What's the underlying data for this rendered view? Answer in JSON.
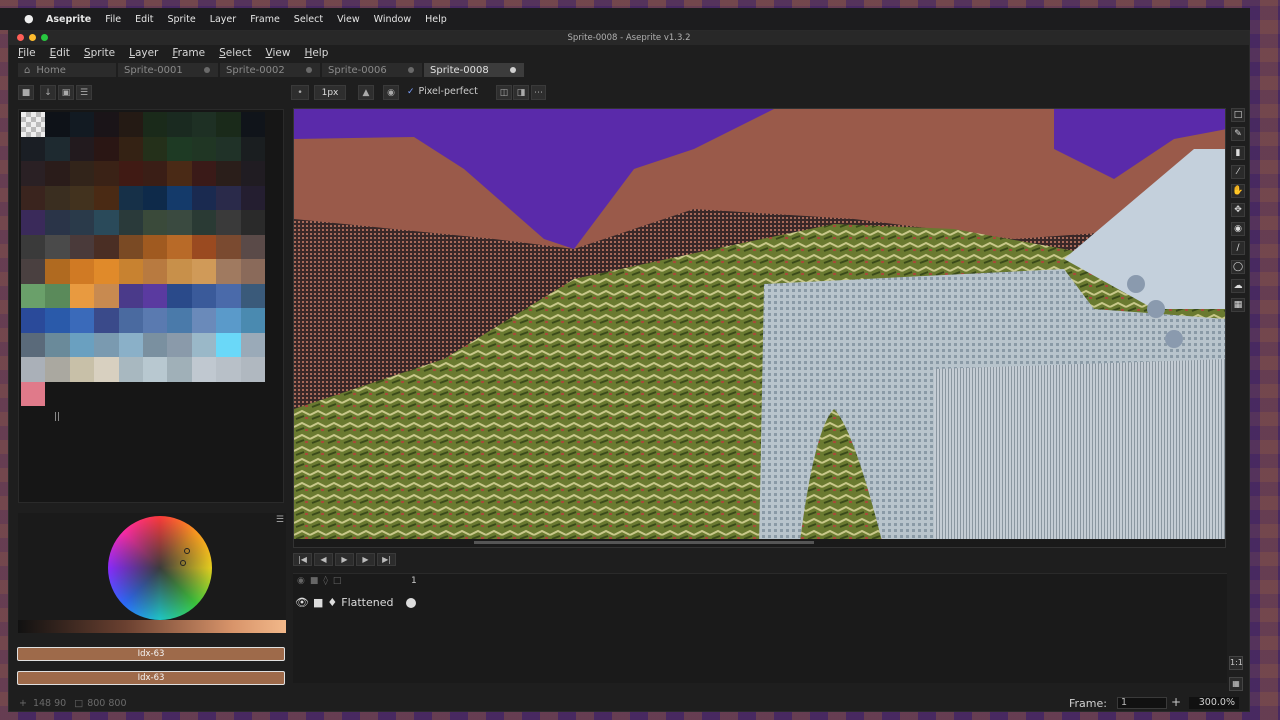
{
  "mac_menubar": {
    "items": [
      "Aseprite",
      "File",
      "Edit",
      "Sprite",
      "Layer",
      "Frame",
      "Select",
      "View",
      "Window",
      "Help"
    ]
  },
  "window": {
    "title": "Sprite-0008 - Aseprite v1.3.2"
  },
  "app_menu": {
    "items": [
      "File",
      "Edit",
      "Sprite",
      "Layer",
      "Frame",
      "Select",
      "View",
      "Help"
    ]
  },
  "tabs": [
    {
      "label": "Home",
      "active": false
    },
    {
      "label": "Sprite-0001",
      "active": false
    },
    {
      "label": "Sprite-0002",
      "active": false
    },
    {
      "label": "Sprite-0006",
      "active": false
    },
    {
      "label": "Sprite-0008",
      "active": true
    }
  ],
  "toolbar": {
    "brush_size": "1px",
    "pixel_perfect_label": "Pixel-perfect"
  },
  "palette": {
    "colors": [
      "#ffffff",
      "#0e1218",
      "#121a22",
      "#1a1418",
      "#241a14",
      "#1a2a1a",
      "#1a2a20",
      "#1e3024",
      "#1a2a1a",
      "#10141a",
      "#1a1e24",
      "#1e2a30",
      "#221a1e",
      "#2a1614",
      "#342214",
      "#24301a",
      "#1e3a24",
      "#203624",
      "#203228",
      "#1a1e20",
      "#2a2024",
      "#2a1c1a",
      "#32241a",
      "#3a2216",
      "#401a14",
      "#3a1e16",
      "#4a2a16",
      "#3a1a18",
      "#2a1e1a",
      "#201c22",
      "#3a241e",
      "#3a2e20",
      "#42321e",
      "#4a2a14",
      "#163048",
      "#0e2a4a",
      "#143a6a",
      "#1a2a50",
      "#2a2a4a",
      "#241e30",
      "#3a2a5a",
      "#2a3448",
      "#2a3a4a",
      "#2a4a5a",
      "#2a3a3a",
      "#3a4a3a",
      "#3a4a40",
      "#2a3a34",
      "#3a3a3a",
      "#2a2a2a",
      "#3a3a3a",
      "#4a4a4a",
      "#4a3a3a",
      "#4a2e24",
      "#7a4a24",
      "#a05a20",
      "#b86a28",
      "#9a4a20",
      "#7a4a30",
      "#5a4a48",
      "#4a4040",
      "#b06a20",
      "#d07a24",
      "#e08a2a",
      "#c88230",
      "#b87a40",
      "#c8904a",
      "#d09a58",
      "#a07a60",
      "#8a6a5a",
      "#6aa06a",
      "#5a8a5a",
      "#e89a40",
      "#c88a50",
      "#4a3a8a",
      "#5a3aa0",
      "#2a4a8a",
      "#3a5a9a",
      "#4a6aaa",
      "#3a5a7a",
      "#2a4a9a",
      "#2a5aaa",
      "#3a6aba",
      "#3a4a8a",
      "#4a6aa0",
      "#5a7ab0",
      "#4a7aaa",
      "#6a8aba",
      "#5a9aca",
      "#4a8ab0",
      "#5a6a7a",
      "#6a8a9a",
      "#6aa0c0",
      "#7a9ab0",
      "#8ab0c8",
      "#7a90a0",
      "#8a9aaa",
      "#9ab8c8",
      "#6ad8f8",
      "#9aaab8",
      "#aab0b8",
      "#aaa8a0",
      "#c8c0a8",
      "#d8d0c0",
      "#a8b8c0",
      "#b8c8d0",
      "#a0b0b8",
      "#c0c8d0",
      "#b8c0c8",
      "#b0b8c0",
      "#e07a8a"
    ]
  },
  "color_bars": {
    "fg_label": "Idx-63",
    "bg_label": "Idx-63"
  },
  "timeline": {
    "frame_number": "1",
    "layer_name": "Flattened"
  },
  "status": {
    "coords": "148 90",
    "size": "800 800",
    "frame_label": "Frame:",
    "frame_value": "1",
    "zoom": "300.0%"
  }
}
